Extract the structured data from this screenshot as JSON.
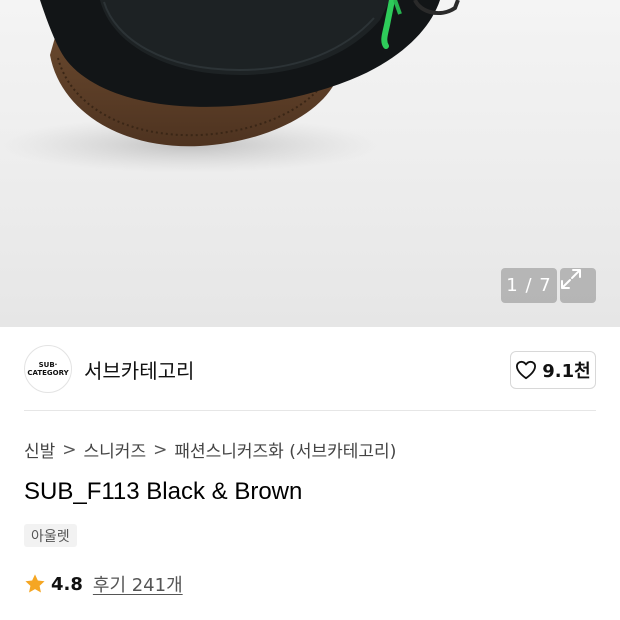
{
  "gallery": {
    "counter": "1 / 7",
    "expand_icon": "expand-arrows-icon"
  },
  "brand": {
    "logo_line1": "SUB·",
    "logo_line2": "CATEGORY",
    "name": "서브카테고리"
  },
  "like": {
    "icon": "heart-outline-icon",
    "count": "9.1천"
  },
  "breadcrumb": {
    "items": [
      "신발",
      "스니커즈",
      "패션스니커즈화 (서브카테고리)"
    ],
    "separator": ">"
  },
  "product": {
    "title": "SUB_F113 Black & Brown",
    "tag": "아울렛"
  },
  "rating": {
    "icon": "star-icon",
    "star_color": "#F5A623",
    "value": "4.8",
    "reviews": "후기 241개"
  }
}
